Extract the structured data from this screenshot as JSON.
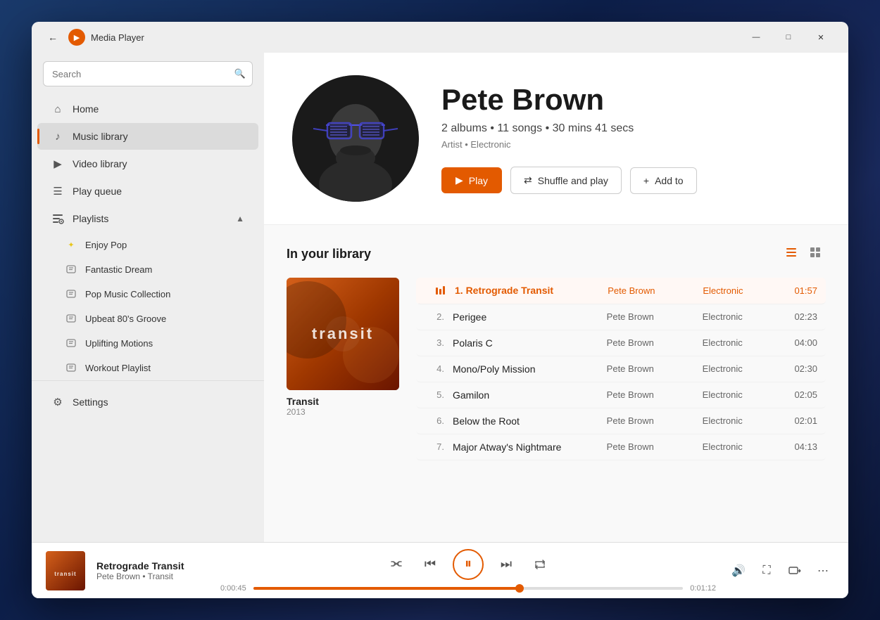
{
  "titlebar": {
    "logo_label": "▶",
    "title": "Media Player",
    "back_label": "←",
    "minimize_label": "—",
    "maximize_label": "□",
    "close_label": "✕"
  },
  "sidebar": {
    "search_placeholder": "Search",
    "items": [
      {
        "id": "home",
        "label": "Home",
        "icon": "⌂"
      },
      {
        "id": "music-library",
        "label": "Music library",
        "icon": "♪",
        "active": true
      },
      {
        "id": "video-library",
        "label": "Video library",
        "icon": "▶"
      },
      {
        "id": "play-queue",
        "label": "Play queue",
        "icon": "☰"
      }
    ],
    "playlists_header": "Playlists",
    "playlists": [
      {
        "id": "enjoy-pop",
        "label": "Enjoy Pop",
        "icon": "✦"
      },
      {
        "id": "fantastic-dream",
        "label": "Fantastic Dream",
        "icon": ""
      },
      {
        "id": "pop-music-collection",
        "label": "Pop Music Collection",
        "icon": ""
      },
      {
        "id": "upbeat-80s-groove",
        "label": "Upbeat 80's Groove",
        "icon": ""
      },
      {
        "id": "uplifting-motions",
        "label": "Uplifting Motions",
        "icon": ""
      },
      {
        "id": "workout-playlist",
        "label": "Workout Playlist",
        "icon": ""
      }
    ],
    "settings_label": "Settings",
    "settings_icon": "⚙"
  },
  "artist": {
    "name": "Pete Brown",
    "meta": "2 albums • 11 songs • 30 mins 41 secs",
    "genre": "Artist • Electronic",
    "play_label": "Play",
    "shuffle_label": "Shuffle and play",
    "add_label": "Add to"
  },
  "library": {
    "title": "In your library",
    "view_list_label": "≡",
    "view_grid_label": "⊞",
    "album": {
      "name": "Transit",
      "year": "2013"
    },
    "tracks": [
      {
        "num": "1.",
        "name": "Retrograde Transit",
        "artist": "Pete Brown",
        "genre": "Electronic",
        "duration": "01:57",
        "playing": true
      },
      {
        "num": "2.",
        "name": "Perigee",
        "artist": "Pete Brown",
        "genre": "Electronic",
        "duration": "02:23",
        "playing": false
      },
      {
        "num": "3.",
        "name": "Polaris C",
        "artist": "Pete Brown",
        "genre": "Electronic",
        "duration": "04:00",
        "playing": false
      },
      {
        "num": "4.",
        "name": "Mono/Poly Mission",
        "artist": "Pete Brown",
        "genre": "Electronic",
        "duration": "02:30",
        "playing": false
      },
      {
        "num": "5.",
        "name": "Gamilon",
        "artist": "Pete Brown",
        "genre": "Electronic",
        "duration": "02:05",
        "playing": false
      },
      {
        "num": "6.",
        "name": "Below the Root",
        "artist": "Pete Brown",
        "genre": "Electronic",
        "duration": "02:01",
        "playing": false
      },
      {
        "num": "7.",
        "name": "Major Atway's Nightmare",
        "artist": "Pete Brown",
        "genre": "Electronic",
        "duration": "04:13",
        "playing": false
      }
    ]
  },
  "now_playing": {
    "title": "Retrograde Transit",
    "artist_album": "Pete Brown • Transit",
    "thumb_text": "transit",
    "current_time": "0:00:45",
    "total_time": "0:01:12",
    "progress_percent": 62
  }
}
